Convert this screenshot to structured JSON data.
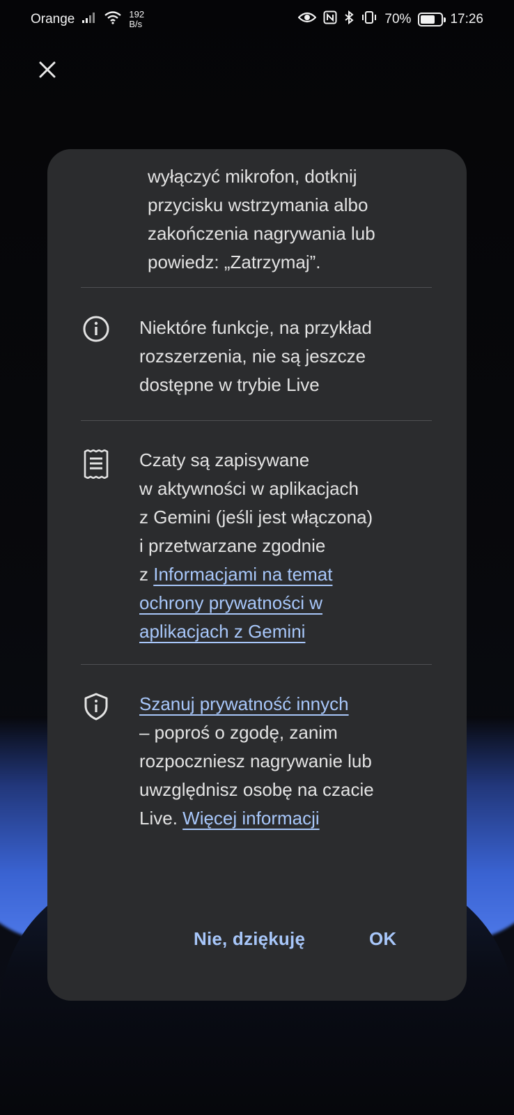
{
  "status_bar": {
    "carrier": "Orange",
    "net_speed_value": "192",
    "net_speed_unit": "B/s",
    "battery": "70%",
    "time": "17:26"
  },
  "dialog": {
    "partial_text_cut": "wyłączyć mikrofon, dotknij przycisku wstrzymania albo zakończenia nagrywania lub powiedz: „Zatrzymaj”.",
    "partial_lines": [
      "wyłączyć mikrofon, dotknij",
      "przycisku wstrzymania albo",
      "zakończenia nagrywania lub",
      "powiedz: „Zatrzymaj”."
    ],
    "items": [
      {
        "icon": "info-icon",
        "lines": [
          "Niektóre funkcje, na przykład",
          "rozszerzenia, nie są jeszcze",
          "dostępne w trybie Live"
        ]
      },
      {
        "icon": "receipt-icon",
        "pre_lines": [
          "Czaty są zapisywane",
          "w aktywności w aplikacjach",
          "z Gemini (jeśli jest włączona)",
          "i przetwarzane zgodnie"
        ],
        "link_prefix": "z ",
        "link_lines": [
          "Informacjami na temat",
          "ochrony prywatności w",
          "aplikacjach z Gemini"
        ]
      },
      {
        "icon": "shield-icon",
        "link_first": "Szanuj prywatność innych",
        "mid_lines": [
          "– poproś o zgodę, zanim",
          "rozpoczniesz nagrywanie lub",
          "uwzględnisz osobę na czacie"
        ],
        "last_prefix": "Live. ",
        "last_link": "Więcej informacji"
      }
    ],
    "buttons": {
      "decline": "Nie, dziękuję",
      "ok": "OK"
    }
  },
  "colors": {
    "dialog_bg": "#2b2c2e",
    "link": "#a8c7fa",
    "text": "#e3e3e3"
  }
}
